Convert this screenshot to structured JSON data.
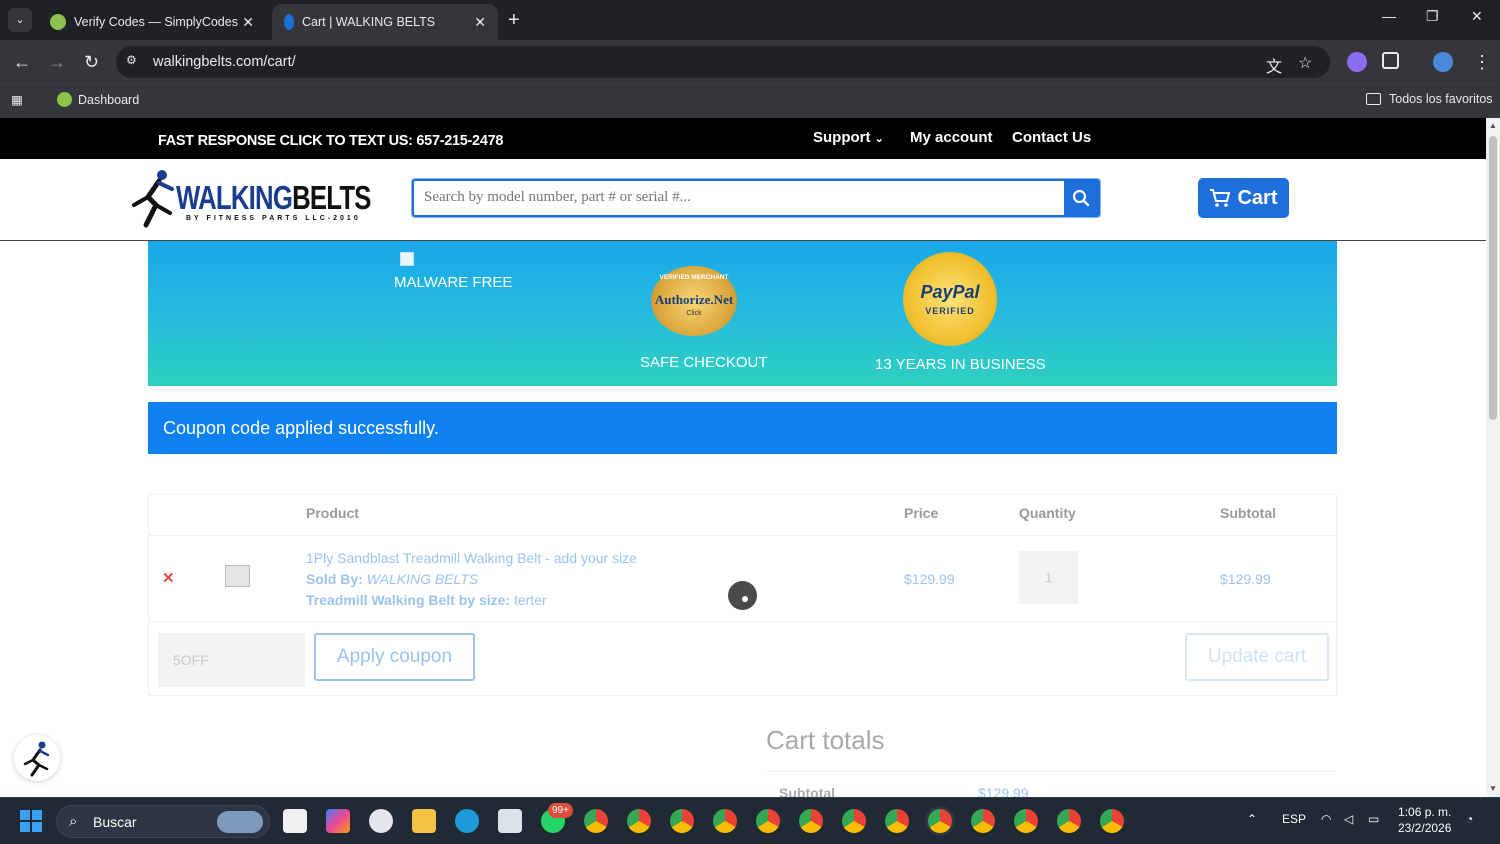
{
  "browser": {
    "tabs": [
      {
        "title": "Verify Codes — SimplyCodes",
        "active": false
      },
      {
        "title": "Cart | WALKING BELTS",
        "active": true
      }
    ],
    "url": "walkingbelts.com/cart/",
    "bookmarks": {
      "dashboard": "Dashboard",
      "all_favorites": "Todos los favoritos"
    }
  },
  "site": {
    "promo": "FAST RESPONSE CLICK TO TEXT US: 657-215-2478",
    "nav": {
      "support": "Support",
      "account": "My account",
      "contact": "Contact Us"
    },
    "logo": {
      "walking": "WALKING",
      "belts": "BELTS",
      "tagline": "BY FITNESS PARTS LLC-2010"
    },
    "search_placeholder": "Search by model number, part # or serial #...",
    "cart_label": "Cart",
    "badges": {
      "malware": "MALWARE FREE",
      "authorize_brand": "Authorize.Net",
      "authorize_ring": "VERIFIED MERCHANT",
      "authorize_click": "Click",
      "safe": "SAFE CHECKOUT",
      "paypal_brand": "PayPal",
      "paypal_verified": "VERIFIED",
      "years": "13 YEARS IN BUSINESS"
    },
    "notice": "Coupon code applied successfully."
  },
  "cart": {
    "headers": {
      "product": "Product",
      "price": "Price",
      "quantity": "Quantity",
      "subtotal": "Subtotal"
    },
    "item": {
      "name": "1Ply Sandblast Treadmill Walking Belt - add your size",
      "sold_by_label": "Sold By:",
      "sold_by": "WALKING BELTS",
      "size_label": "Treadmill Walking Belt by size:",
      "size": "terter",
      "price": "$129.99",
      "quantity": "1",
      "subtotal": "$129.99"
    },
    "coupon_value": "5OFF",
    "apply": "Apply coupon",
    "update": "Update cart"
  },
  "totals": {
    "title": "Cart totals",
    "subtotal_label": "Subtotal",
    "subtotal_value": "$129.99"
  },
  "taskbar": {
    "search": "Buscar",
    "badge": "99+",
    "lang": "ESP",
    "time": "1:06 p. m.",
    "date": "23/2/2026"
  },
  "colors": {
    "accent": "#1e6fd9",
    "notice": "#0f80f0",
    "remove": "#e24b4b",
    "link": "#9cc3ee"
  }
}
